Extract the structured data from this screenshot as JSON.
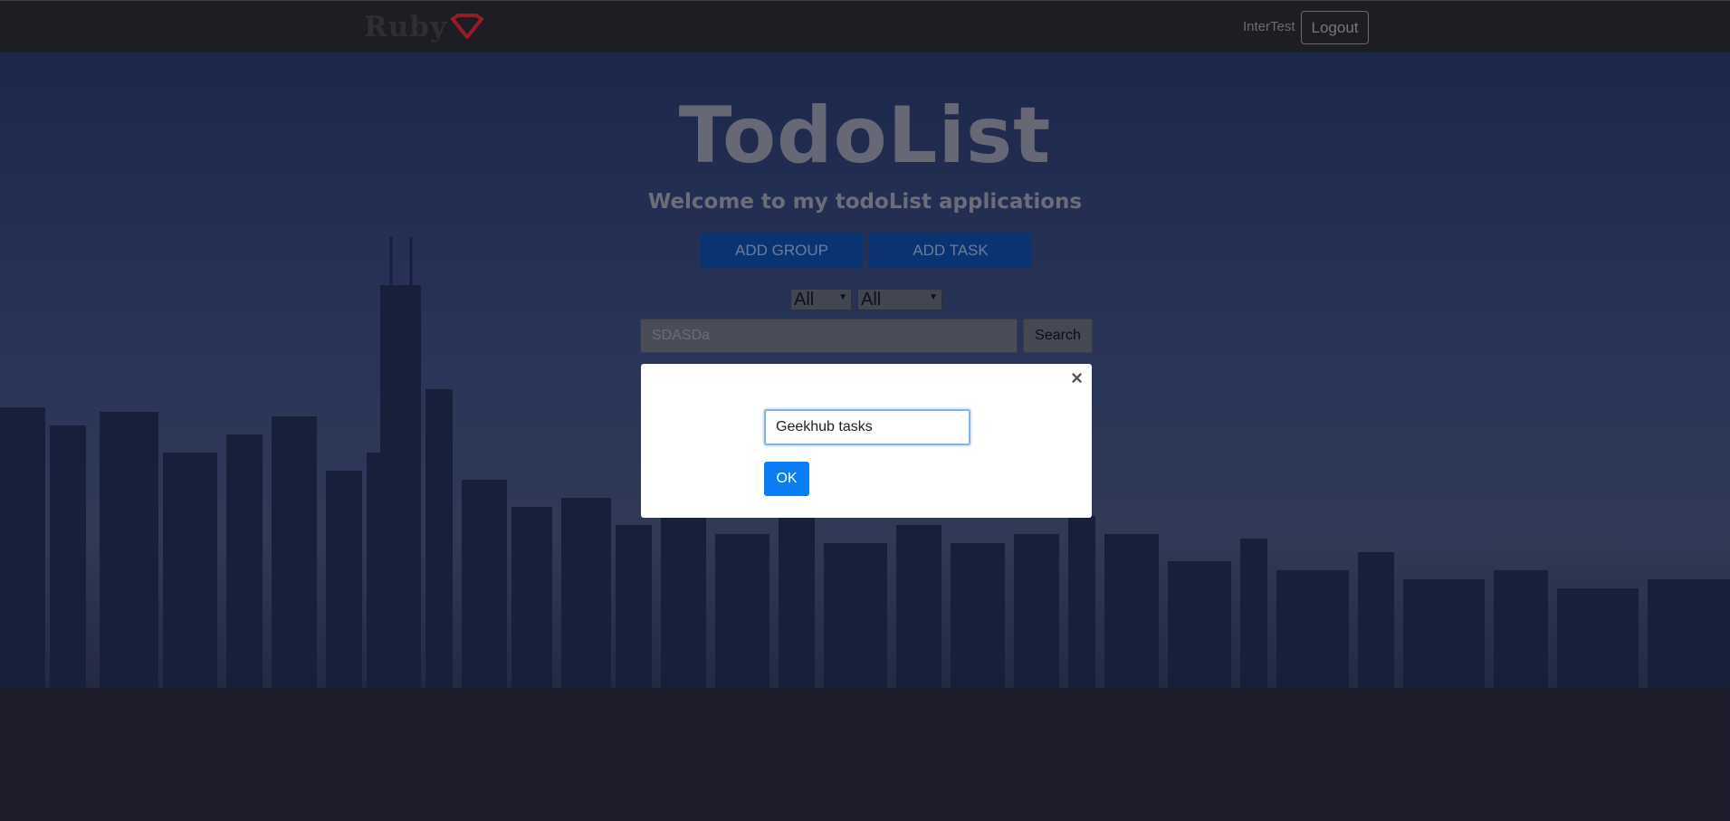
{
  "navbar": {
    "logo_text": "Ruby",
    "user_name": "InterTest",
    "logout_label": "Logout"
  },
  "hero": {
    "title": "TodoList",
    "subtitle": "Welcome to my todoList applications",
    "add_group_label": "ADD GROUP",
    "add_task_label": "ADD TASK"
  },
  "filters": {
    "select_1_value": "All",
    "select_2_value": "All"
  },
  "search": {
    "value": "SDASDa",
    "button_label": "Search"
  },
  "modal": {
    "close_label": "×",
    "input_value": "Geekhub tasks",
    "ok_label": "OK"
  },
  "colors": {
    "brand_blue": "#0a7cf4",
    "logo_red": "#c0202a"
  }
}
